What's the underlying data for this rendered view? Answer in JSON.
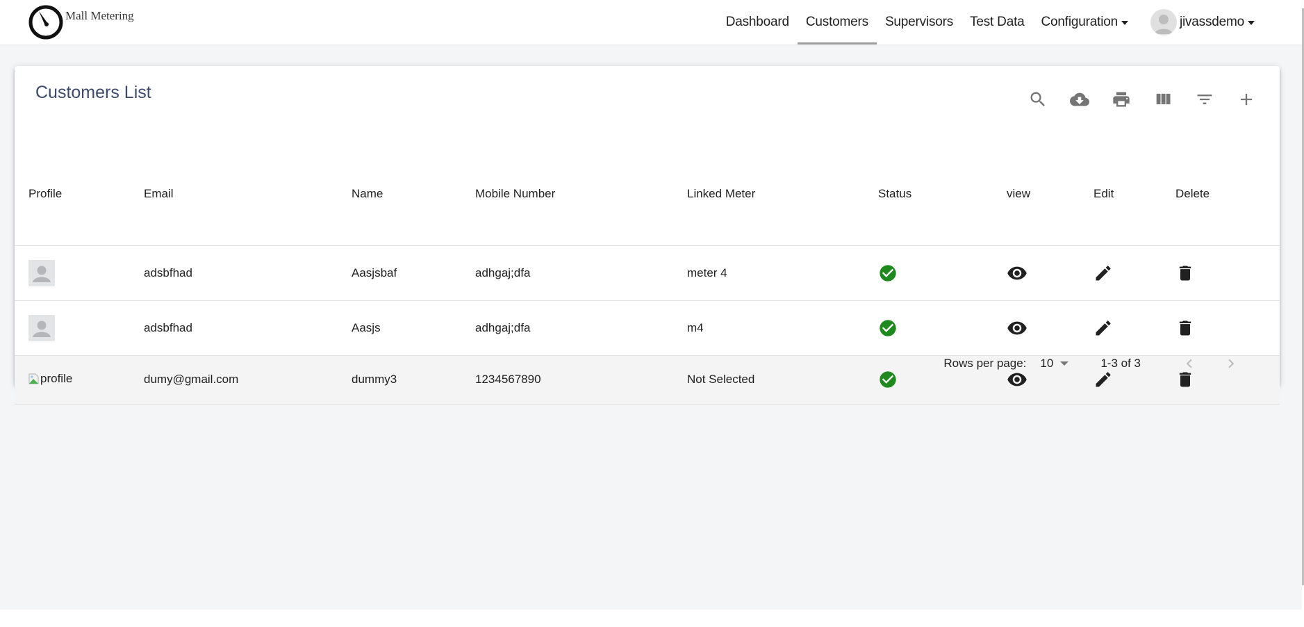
{
  "app": {
    "logo_text": "Mall Metering"
  },
  "nav": {
    "items": [
      {
        "label": "Dashboard",
        "active": false
      },
      {
        "label": "Customers",
        "active": true
      },
      {
        "label": "Supervisors",
        "active": false
      },
      {
        "label": "Test Data",
        "active": false
      },
      {
        "label": "Configuration",
        "active": false,
        "dropdown": true
      }
    ],
    "user": {
      "name": "jivassdemo",
      "icon": "user-avatar-icon"
    }
  },
  "card": {
    "title": "Customers List",
    "toolbar": [
      {
        "name": "search",
        "icon": "search-icon"
      },
      {
        "name": "download-csv",
        "icon": "cloud-download-icon"
      },
      {
        "name": "print",
        "icon": "print-icon"
      },
      {
        "name": "view-columns",
        "icon": "view-columns-icon"
      },
      {
        "name": "filter",
        "icon": "filter-list-icon"
      },
      {
        "name": "add",
        "icon": "add-icon"
      }
    ]
  },
  "table": {
    "columns": [
      "Profile",
      "Email",
      "Name",
      "Mobile Number",
      "Linked Meter",
      "Status",
      "view",
      "Edit",
      "Delete"
    ],
    "rows": [
      {
        "profile": "avatar-placeholder",
        "email": "adsbfhad",
        "name": "Aasjsbaf",
        "mobile": "adhgaj;dfa",
        "meter": "meter 4",
        "status": "active"
      },
      {
        "profile": "avatar-placeholder",
        "email": "adsbfhad",
        "name": "Aasjs",
        "mobile": "adhgaj;dfa",
        "meter": "m4",
        "status": "active"
      },
      {
        "profile": "profile",
        "email": "dumy@gmail.com",
        "name": "dummy3",
        "mobile": "1234567890",
        "meter": "Not Selected",
        "status": "active"
      }
    ],
    "status_color": "#1e8a1e"
  },
  "pagination": {
    "rows_per_page_label": "Rows per page:",
    "rows_per_page": "10",
    "range": "1-3 of 3"
  }
}
